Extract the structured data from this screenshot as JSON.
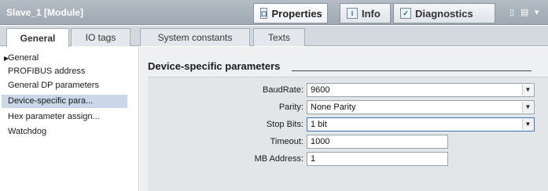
{
  "window": {
    "title": "Slave_1 [Module]",
    "tabs": [
      {
        "label": "Properties",
        "icon": "properties-icon"
      },
      {
        "label": "Info",
        "icon": "info-icon"
      },
      {
        "label": "Diagnostics",
        "icon": "diagnostics-icon"
      }
    ],
    "controls": [
      "restore-icon",
      "menu-icon"
    ]
  },
  "subtabs": [
    {
      "label": "General"
    },
    {
      "label": "IO tags"
    },
    {
      "label": "System constants"
    },
    {
      "label": "Texts"
    }
  ],
  "nav": {
    "items": [
      {
        "label": "General"
      },
      {
        "label": "PROFIBUS address"
      },
      {
        "label": "General DP parameters"
      },
      {
        "label": "Device-specific para..."
      },
      {
        "label": "Hex parameter assign..."
      },
      {
        "label": "Watchdog"
      }
    ]
  },
  "section": {
    "title": "Device-specific parameters"
  },
  "params": {
    "baudrate": {
      "label": "BaudRate:",
      "value": "9600"
    },
    "parity": {
      "label": "Parity:",
      "value": "None Parity"
    },
    "stopbits": {
      "label": "Stop Bits:",
      "value": "1 bit"
    },
    "timeout": {
      "label": "Timeout:",
      "value": "1000"
    },
    "mbaddress": {
      "label": "MB Address:",
      "value": "1"
    }
  }
}
